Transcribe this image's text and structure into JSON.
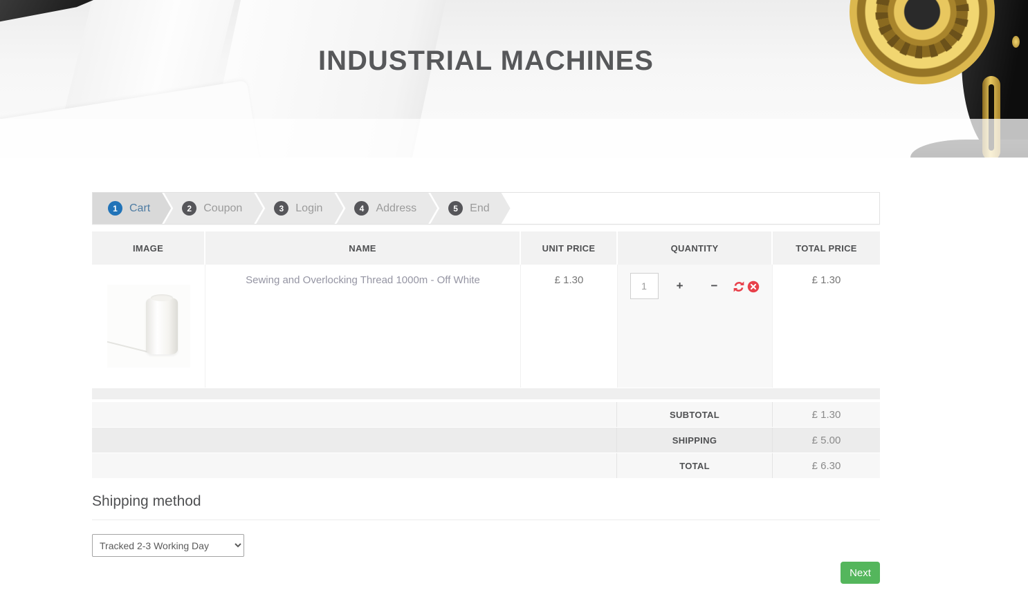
{
  "header": {
    "title": "INDUSTRIAL MACHINES"
  },
  "stepper": {
    "steps": [
      {
        "num": "1",
        "label": "Cart"
      },
      {
        "num": "2",
        "label": "Coupon"
      },
      {
        "num": "3",
        "label": "Login"
      },
      {
        "num": "4",
        "label": "Address"
      },
      {
        "num": "5",
        "label": "End"
      }
    ]
  },
  "cart": {
    "columns": [
      "IMAGE",
      "NAME",
      "UNIT PRICE",
      "QUANTITY",
      "TOTAL PRICE"
    ],
    "item": {
      "name": "Sewing and Overlocking Thread 1000m - Off White",
      "unit_price": "£ 1.30",
      "quantity": "1",
      "total_price": "£ 1.30",
      "plus_label": "+",
      "minus_label": "−"
    },
    "totals": [
      {
        "label": "SUBTOTAL",
        "value": "£ 1.30"
      },
      {
        "label": "SHIPPING",
        "value": "£ 5.00"
      },
      {
        "label": "TOTAL",
        "value": "£ 6.30"
      }
    ]
  },
  "shipping": {
    "heading": "Shipping method",
    "selected_option": "Tracked 2-3 Working Day"
  },
  "actions": {
    "next_label": "Next"
  },
  "colors": {
    "accent_blue": "#2173b8",
    "danger_red": "#e8414b",
    "success_green": "#54b65c"
  }
}
